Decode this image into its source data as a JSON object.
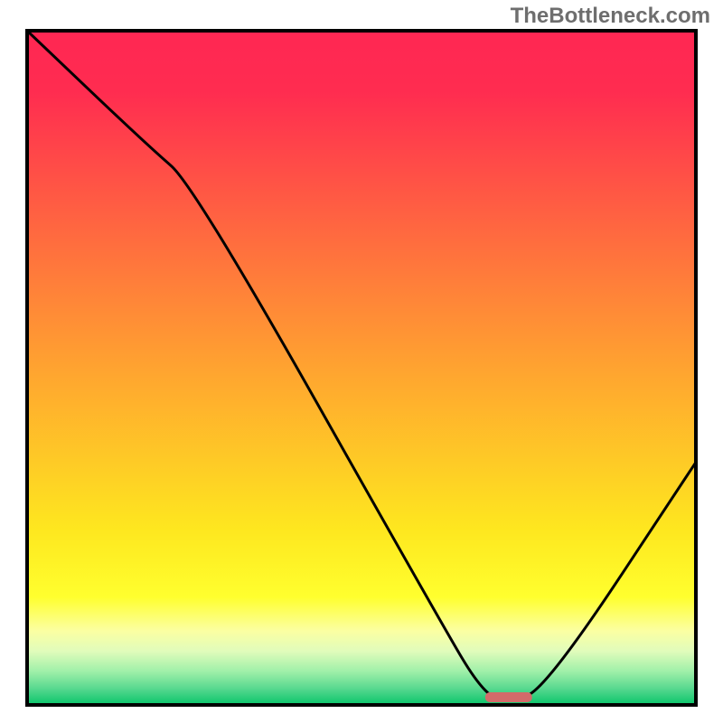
{
  "watermark": "TheBottleneck.com",
  "chart_data": {
    "type": "line",
    "title": "",
    "xlabel": "",
    "ylabel": "",
    "xlim": [
      0,
      100
    ],
    "ylim": [
      0,
      100
    ],
    "grid": false,
    "series": [
      {
        "name": "bottleneck-curve",
        "x": [
          0,
          18,
          25,
          62,
          68,
          72,
          78,
          100
        ],
        "values": [
          100,
          83,
          77,
          12,
          2,
          0,
          3,
          36
        ]
      }
    ],
    "marker": {
      "name": "minimum-region",
      "x_center": 72,
      "width": 7,
      "color": "#d36b6a"
    },
    "background_gradient": {
      "type": "vertical",
      "stops": [
        {
          "pos": 0.0,
          "color": "#ff2753"
        },
        {
          "pos": 0.09,
          "color": "#ff2c50"
        },
        {
          "pos": 0.5,
          "color": "#ffa330"
        },
        {
          "pos": 0.74,
          "color": "#fee71f"
        },
        {
          "pos": 0.84,
          "color": "#ffff2e"
        },
        {
          "pos": 0.89,
          "color": "#fbffa2"
        },
        {
          "pos": 0.92,
          "color": "#e1fcbb"
        },
        {
          "pos": 0.95,
          "color": "#a0f0a9"
        },
        {
          "pos": 0.975,
          "color": "#5ad990"
        },
        {
          "pos": 1.0,
          "color": "#09c46a"
        }
      ]
    },
    "border_color": "#000000",
    "border_width": 4,
    "curve_color": "#000000",
    "curve_width": 3
  }
}
